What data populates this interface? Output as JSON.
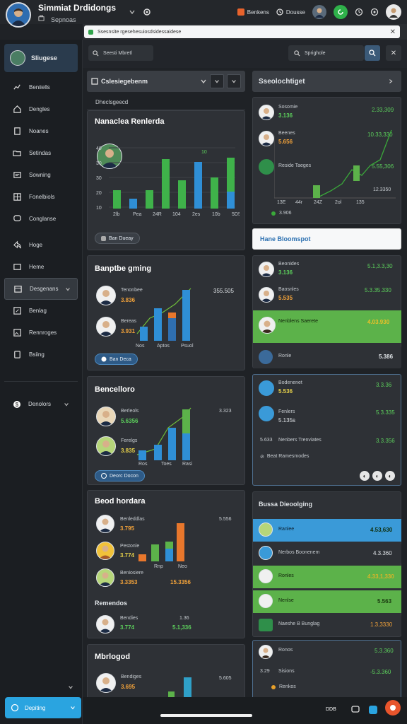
{
  "app": {
    "title": "Simmiat Drdidongs",
    "subtitle": "Sepnoas",
    "top_pill_1": "Benkens",
    "top_pill_2": "Dousse"
  },
  "browser": {
    "url": "Ssesnsite rgesehesuiosdsidessaidese"
  },
  "search": {
    "left_placeholder": "Seesti Mbretl",
    "right_placeholder": "Sprighole"
  },
  "sidebar": {
    "user": "Sliugese",
    "items": [
      {
        "label": "Beniiells",
        "icon": "chart-icon"
      },
      {
        "label": "Dengles",
        "icon": "home-icon"
      },
      {
        "label": "Noanes",
        "icon": "document-icon"
      },
      {
        "label": "Setindas",
        "icon": "folder-icon"
      },
      {
        "label": "Sowning",
        "icon": "list-icon"
      },
      {
        "label": "Fonelbiols",
        "icon": "grid-icon"
      },
      {
        "label": "Conglanse",
        "icon": "chat-icon"
      },
      {
        "label": "Hoge",
        "icon": "share-icon"
      },
      {
        "label": "Heme",
        "icon": "box-icon"
      },
      {
        "label": "Desgenans",
        "icon": "calendar-icon"
      },
      {
        "label": "Benlag",
        "icon": "edit-icon"
      },
      {
        "label": "Rennroges",
        "icon": "image-icon"
      },
      {
        "label": "Bsiing",
        "icon": "tablet-icon"
      }
    ],
    "footer_item": "Denolors",
    "bottom_button": "Depiting"
  },
  "left": {
    "select_title": "Cslesiegebenm",
    "sub_header": "Dheclsgeecd",
    "p1": {
      "title": "Nanaclea Renlerda",
      "tag": "Ban Dueay",
      "y_ticks": [
        "40",
        "30",
        "30",
        "20",
        "10"
      ],
      "x_ticks": [
        "2lb",
        "Pea",
        "24R",
        "104",
        "2es",
        "10b",
        "5D5"
      ],
      "bar_label": "10"
    },
    "p2": {
      "title": "Banptbe gming",
      "row1_name": "Tenonbee",
      "row1_val": "3.836",
      "row2_name": "Bereas",
      "row2_val": "3.931",
      "right_val": "355.505",
      "x_ticks": [
        "Nos",
        "Aptos",
        "Psuol"
      ],
      "tag": "Ban Deca"
    },
    "p3": {
      "title": "Bencelloro",
      "row1_name": "Berleols",
      "row1_val": "5.6356",
      "row2_name": "Ferelgs",
      "row2_val": "3.835",
      "right_val": "3.323",
      "x_ticks": [
        "Ros",
        "Toes",
        "Rasi"
      ],
      "tag": "Deorc Docon"
    },
    "p4": {
      "title": "Beod hordara",
      "row1_name": "Benleddlas",
      "row1_val": "3.795",
      "row2_name": "Pestonle",
      "row2_val": "3.774",
      "row3_name": "Beniosiere",
      "row3_val": "3.3353",
      "right_val": "5.556",
      "right_val2": "15.3356",
      "x_ticks": [
        "Rnp",
        "Neo"
      ],
      "sub_title": "Remendos",
      "row4_name": "Bendies",
      "row4_val": "3.774",
      "row4_right": "1.36",
      "row4_right2": "5.1,336"
    },
    "p5": {
      "title": "Mbrlogod",
      "row1_name": "Bendiges",
      "row1_val": "3.695",
      "right_val": "5.605"
    }
  },
  "right": {
    "header": "Sseolochtiget",
    "list1": [
      {
        "name": "Sosomie",
        "sub": "3.136",
        "val": "2.33,309"
      },
      {
        "name": "Beenes",
        "sub": "5.656",
        "val": "10.33,330"
      },
      {
        "name": "Reside Taeges",
        "sub": "",
        "val": "5.55,306"
      }
    ],
    "list1_x": [
      "13E",
      "44r",
      "24Z",
      "2ol",
      "135"
    ],
    "list1_y": "12.3350",
    "list1_legend": "3.906",
    "banner": "Hane Bloomspot",
    "list2": [
      {
        "name": "Beonides",
        "sub": "3.136",
        "val": "5.1,3.3,30"
      },
      {
        "name": "Baosnles",
        "sub": "5.535",
        "val": "5.3.35.330"
      },
      {
        "name": "Nenblens Saerete",
        "sub": "",
        "val": "4.03.930"
      },
      {
        "name": "Ronle",
        "sub": "",
        "val": "5.386"
      }
    ],
    "list3": [
      {
        "name": "Bodenenet",
        "sub": "5.536",
        "val": "3.3.36"
      },
      {
        "name": "Fenlers",
        "sub": "5.135s",
        "val": "5.3.335"
      },
      {
        "name": "Nenbers Trenviates",
        "sub": "5.633",
        "val": "3.3.356"
      }
    ],
    "list3_footer": "Beat Ramesmodes",
    "list4_header": "Bussa Dieoolging",
    "list4": [
      {
        "name": "Ranlee",
        "val": "4.53,630"
      },
      {
        "name": "Nerbos Boonenem",
        "val": "4.3.360"
      },
      {
        "name": "Ronles",
        "val": "4.33,1,330"
      },
      {
        "name": "Nenlse",
        "val": "5.563"
      },
      {
        "name": "Naeshe B Bunglag",
        "val": "1.3,3330"
      }
    ],
    "list5": [
      {
        "name": "Ronos",
        "val": "5.3.360"
      },
      {
        "name": "Sisions",
        "val": "-5.3.360"
      },
      {
        "name": "Renkos",
        "val": ""
      }
    ],
    "list5_left": "3.29"
  },
  "bottom": {
    "label": "DDB"
  }
}
